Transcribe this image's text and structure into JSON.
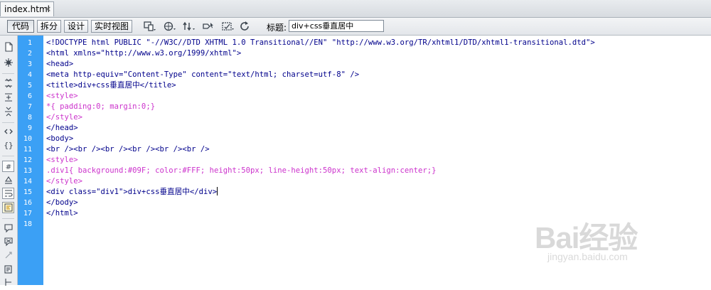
{
  "tab": {
    "filename": "index.html",
    "close": "×"
  },
  "toolbar": {
    "view_buttons": [
      "代码",
      "拆分",
      "设计",
      "实时视图"
    ],
    "title_label": "标题:",
    "title_value": "div+css垂直居中",
    "icons": [
      "multiscreen-icon",
      "preview-globe-icon",
      "file-management-icon",
      "inspect-icon",
      "visual-aids-icon",
      "refresh-icon"
    ]
  },
  "rail_icons": [
    "open-documents-icon",
    "show-code-navigator-icon",
    "collapse-full-tag-icon",
    "collapse-selection-icon",
    "expand-all-icon",
    "select-parent-tag-icon",
    "balance-braces-icon",
    "line-numbers-icon",
    "highlight-invalid-code-icon",
    "word-wrap-icon",
    "syntax-coloring-icon",
    "apply-comment-icon",
    "remove-comment-icon",
    "wrap-tag-icon",
    "recent-snippets-icon",
    "move-css-icon"
  ],
  "line_numbers": [
    "1",
    "2",
    "3",
    "4",
    "5",
    "6",
    "7",
    "8",
    "9",
    "10",
    "11",
    "12",
    "13",
    "14",
    "15",
    "16",
    "17",
    "18"
  ],
  "code": {
    "l1": "<!DOCTYPE html PUBLIC \"-//W3C//DTD XHTML 1.0 Transitional//EN\" \"http://www.w3.org/TR/xhtml1/DTD/xhtml1-transitional.dtd\">",
    "l2": "<html xmlns=\"http://www.w3.org/1999/xhtml\">",
    "l3": "<head>",
    "l4": "<meta http-equiv=\"Content-Type\" content=\"text/html; charset=utf-8\" />",
    "l5": "<title>div+css垂直居中</title>",
    "l6": "<style>",
    "l7": "*{ padding:0; margin:0;}",
    "l8": "</style>",
    "l9": "</head>",
    "l10": "<body>",
    "l11": "<br /><br /><br /><br /><br /><br />",
    "l12": "<style>",
    "l13": ".div1{ background:#09F; color:#FFF; height:50px; line-height:50px; text-align:center;}",
    "l14": "</style>",
    "l15": "<div class=\"div1\">div+css垂直居中</div>",
    "l16": "</body>",
    "l17": "</html>",
    "l18": ""
  },
  "colors": {
    "gutter": "#3ba0f5",
    "tag": "#00008b",
    "css": "#cc33cc"
  },
  "watermark": {
    "brand": "Bai经验",
    "url": "jingyan.baidu.com"
  }
}
